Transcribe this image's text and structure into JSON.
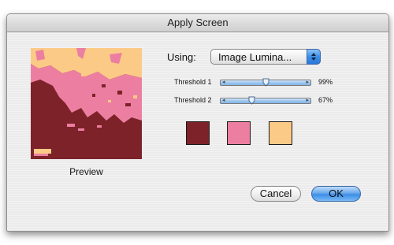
{
  "window": {
    "title": "Apply Screen"
  },
  "preview": {
    "caption": "Preview"
  },
  "using": {
    "label": "Using:",
    "selected": "Image Lumina..."
  },
  "thresholds": [
    {
      "label": "Threshold 1",
      "value": 99,
      "display": "99%"
    },
    {
      "label": "Threshold 2",
      "value": 67,
      "display": "67%"
    }
  ],
  "swatches": [
    {
      "color": "#7d2229"
    },
    {
      "color": "#ec7fa1"
    },
    {
      "color": "#fcca87"
    }
  ],
  "buttons": {
    "cancel": "Cancel",
    "ok": "OK"
  }
}
